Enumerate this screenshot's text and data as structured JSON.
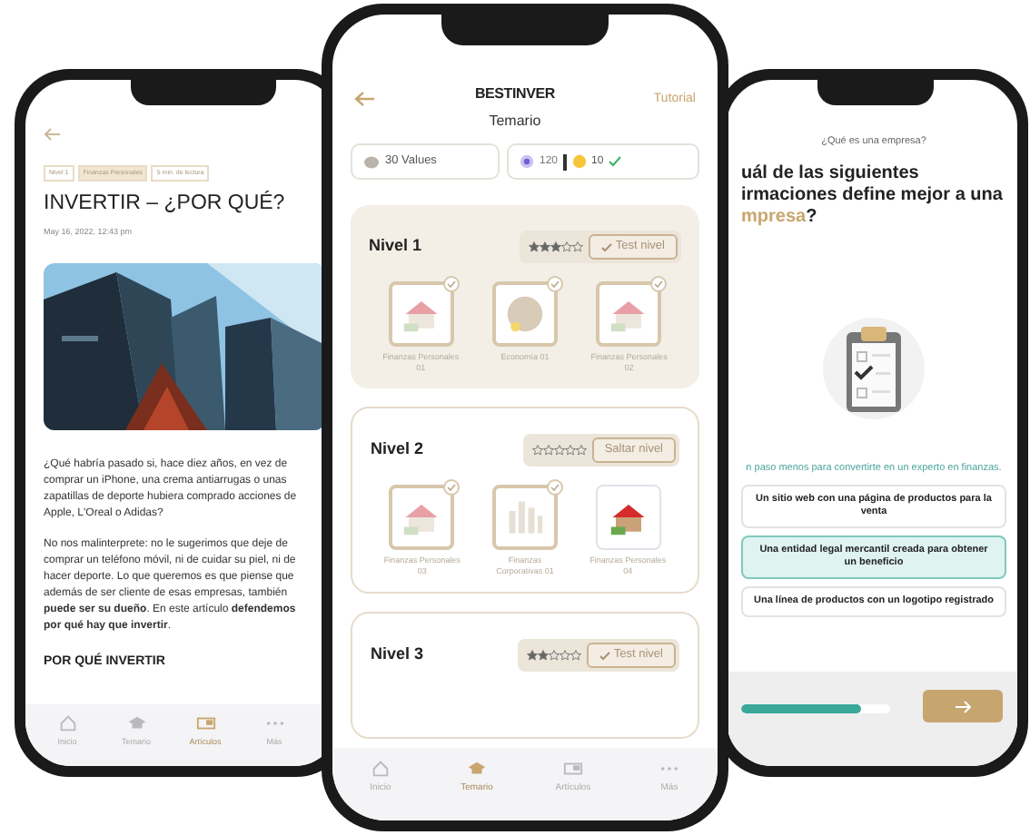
{
  "article_phone": {
    "tags": [
      "Nivel 1",
      "Finanzas Personales",
      "5 min. de lectura"
    ],
    "title": "INVERTIR – ¿POR QUÉ?",
    "date": "May 16, 2022, 12:43 pm",
    "paragraphs": [
      "¿Qué habría pasado si, hace diez años, en vez de comprar un iPhone, una crema antiarrugas o unas zapatillas de deporte hubiera comprado acciones de Apple, L'Oreal o Adidas?",
      "No nos malinterprete: no le sugerimos que deje de comprar un teléfono móvil, ni de cuidar su piel, ni de hacer deporte. Lo que queremos es que piense que además de ser cliente de esas empresas, también **puede ser su dueño**. En este artículo **defendemos por qué hay que invertir**."
    ],
    "subheading": "POR QUÉ INVERTIR",
    "tabs": [
      {
        "label": "Inicio",
        "kind": "home",
        "selected": false
      },
      {
        "label": "Temario",
        "kind": "cap",
        "selected": false
      },
      {
        "label": "Artículos",
        "kind": "news",
        "selected": true
      },
      {
        "label": "Más",
        "kind": "more",
        "selected": false
      }
    ]
  },
  "syllabus_phone": {
    "logo": "BESTINVER",
    "title": "Temario",
    "tutorial": "Tutorial",
    "values": "30 Values",
    "gems": "120",
    "coins": "10",
    "levels": [
      {
        "name": "Nivel 1",
        "stars": 3,
        "current": true,
        "action": "Test nivel",
        "kind": "test",
        "topics": [
          {
            "label": "Finanzas Personales 01",
            "kind": "house",
            "done": true
          },
          {
            "label": "Economía 01",
            "kind": "coin",
            "done": true
          },
          {
            "label": "Finanzas Personales 02",
            "kind": "house",
            "done": true
          }
        ]
      },
      {
        "name": "Nivel 2",
        "stars": 0,
        "current": false,
        "action": "Saltar nivel",
        "kind": "skip",
        "topics": [
          {
            "label": "Finanzas Personales 03",
            "kind": "house",
            "done": true
          },
          {
            "label": "Finanzas Corporativas 01",
            "kind": "chart",
            "done": true
          },
          {
            "label": "Finanzas Personales 04",
            "kind": "house",
            "done": false
          }
        ]
      },
      {
        "name": "Nivel 3",
        "stars": 2,
        "current": false,
        "action": "Test nivel",
        "kind": "test"
      }
    ],
    "tabs": [
      {
        "label": "Inicio",
        "kind": "home",
        "selected": false
      },
      {
        "label": "Temario",
        "kind": "cap",
        "selected": true
      },
      {
        "label": "Artículos",
        "kind": "news",
        "selected": false
      },
      {
        "label": "Más",
        "kind": "more",
        "selected": false
      }
    ]
  },
  "quiz_phone": {
    "topic": "¿Qué es una empresa?",
    "question_lines": [
      [
        {
          "text": "uál de las siguientes",
          "accent": false
        }
      ],
      [
        {
          "text": "irmaciones define mejor a una",
          "accent": false
        }
      ],
      [
        {
          "text": "mpresa",
          "accent": true
        },
        {
          "text": "?",
          "accent": false
        }
      ]
    ],
    "hint": "n paso menos para convertirte en un experto en finanzas.",
    "options": [
      {
        "label": "Un sitio web con una página de productos para la venta",
        "selected": false
      },
      {
        "label": "Una entidad legal mercantil creada para obtener un beneficio",
        "selected": true
      },
      {
        "label": "Una línea de productos con un logotipo registrado",
        "selected": false
      }
    ],
    "progress": {
      "level": 0.8
    }
  }
}
